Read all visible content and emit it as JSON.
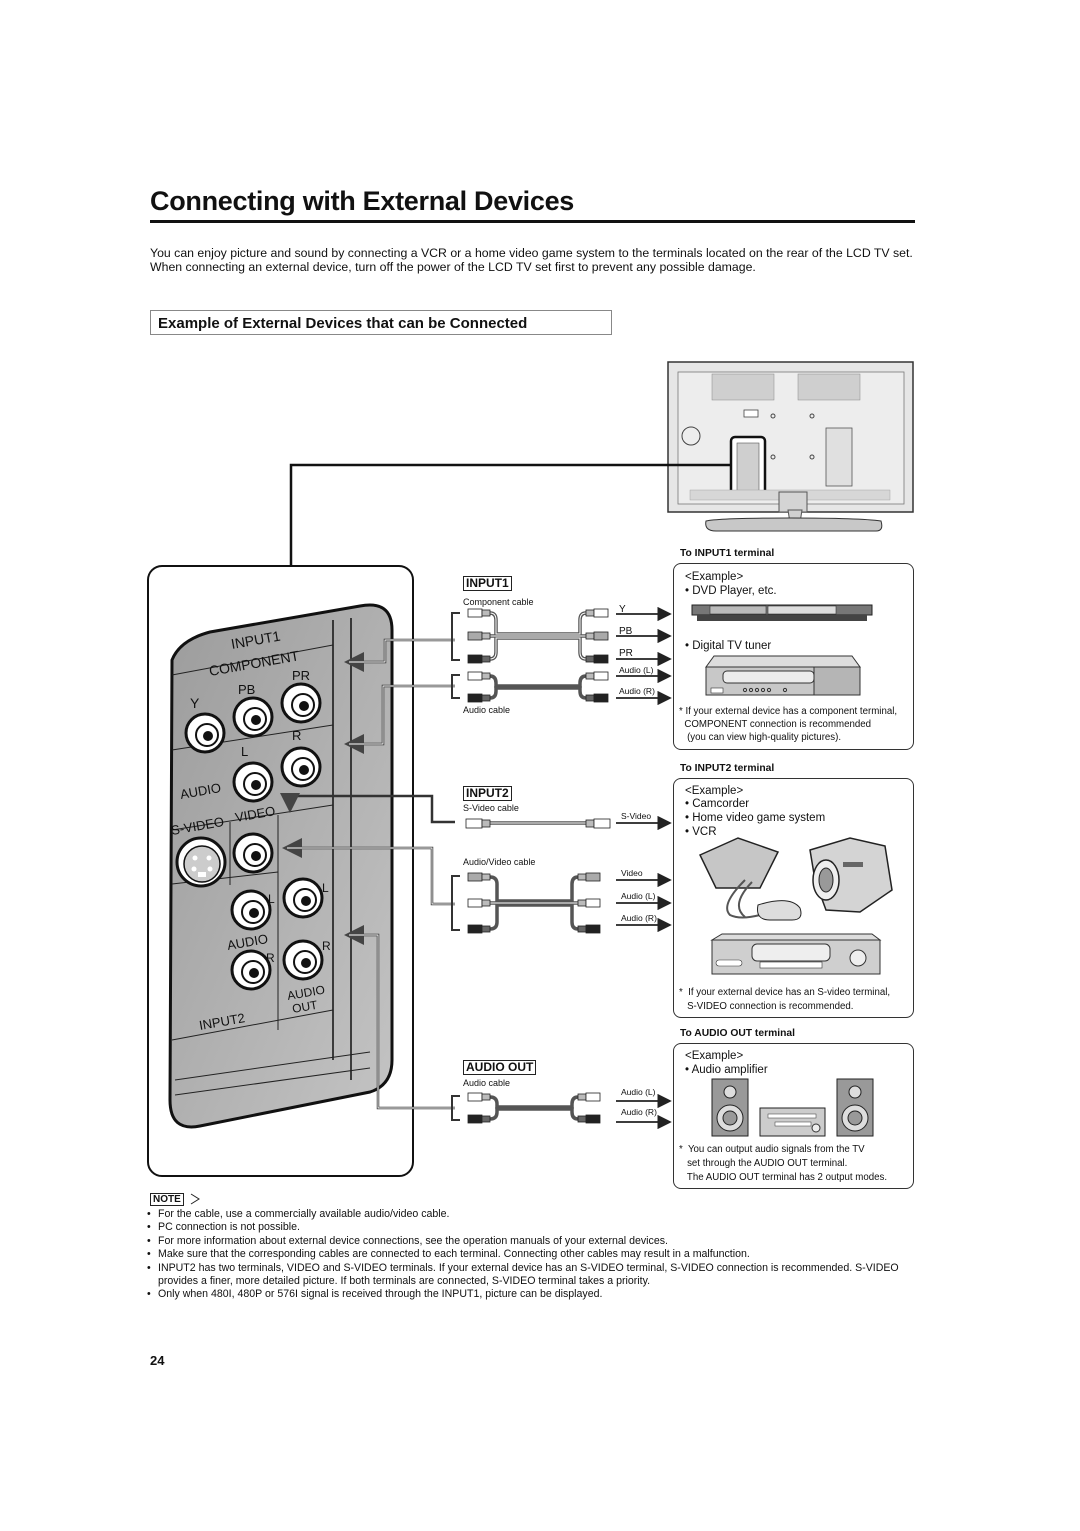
{
  "page": {
    "title": "Connecting with External Devices",
    "intro": [
      "You can enjoy picture and sound by connecting a VCR or a home video game system to the terminals located on the rear of the LCD TV set.",
      "When connecting an external device, turn off the power of the LCD TV set first to prevent any possible damage."
    ],
    "subheading": "Example of External Devices that can be Connected",
    "page_number": "24"
  },
  "panel": {
    "labels": {
      "input1": "INPUT1",
      "component": "COMPONENT",
      "y": "Y",
      "pb": "PB",
      "pr": "PR",
      "l": "L",
      "r": "R",
      "audio": "AUDIO",
      "svideo": "S-VIDEO",
      "video": "VIDEO",
      "input2": "INPUT2",
      "audio_out_1": "AUDIO",
      "audio_out_2": "OUT"
    }
  },
  "cables": {
    "input1": {
      "label": "INPUT1",
      "component_cable": "Component cable",
      "audio_cable": "Audio cable",
      "signals": [
        "Y",
        "PB",
        "PR",
        "Audio (L)",
        "Audio (R)"
      ]
    },
    "input2": {
      "label": "INPUT2",
      "svideo_cable": "S-Video cable",
      "av_cable": "Audio/Video cable",
      "signals": [
        "S-Video",
        "Video",
        "Audio (L)",
        "Audio (R)"
      ]
    },
    "audio_out": {
      "label": "AUDIO OUT",
      "audio_cable": "Audio cable",
      "signals": [
        "Audio (L)",
        "Audio (R)"
      ]
    }
  },
  "terminals": [
    {
      "heading": "To  INPUT1 terminal",
      "example": "<Example>",
      "items": [
        "• DVD Player, etc.",
        "• Digital TV tuner"
      ],
      "footnote": [
        "* If your external device has a component terminal,",
        "  COMPONENT connection is recommended",
        "   (you can view high-quality pictures)."
      ]
    },
    {
      "heading": "To INPUT2 terminal",
      "example": "<Example>",
      "items": [
        "• Camcorder",
        "• Home video game system",
        "• VCR"
      ],
      "footnote": [
        "*  If your external device has an S-video terminal,",
        "   S-VIDEO connection is recommended."
      ]
    },
    {
      "heading": "To AUDIO OUT terminal",
      "example": "<Example>",
      "items": [
        "• Audio amplifier"
      ],
      "footnote": [
        "*  You can output audio signals from the TV",
        "   set through the AUDIO OUT terminal.",
        "   The AUDIO OUT terminal has 2 output modes."
      ]
    }
  ],
  "note": {
    "badge": "NOTE",
    "items": [
      "For the cable, use a commercially available audio/video cable.",
      "PC connection is not possible.",
      "For more information about external device connections, see the operation manuals of your external devices.",
      "Make sure that the corresponding cables are connected to each terminal. Connecting other cables may result in a malfunction.",
      "INPUT2 has two terminals, VIDEO and S-VIDEO terminals. If your external device has an S-VIDEO terminal, S-VIDEO connection is recommended. S-VIDEO provides a finer, more detailed picture. If both terminals are connected, S-VIDEO terminal takes a priority.",
      "Only when 480I, 480P or 576I signal is received through the INPUT1, picture can be displayed."
    ]
  },
  "colors": {
    "panel_gray": "#a8a8a8",
    "ink": "#111111"
  }
}
